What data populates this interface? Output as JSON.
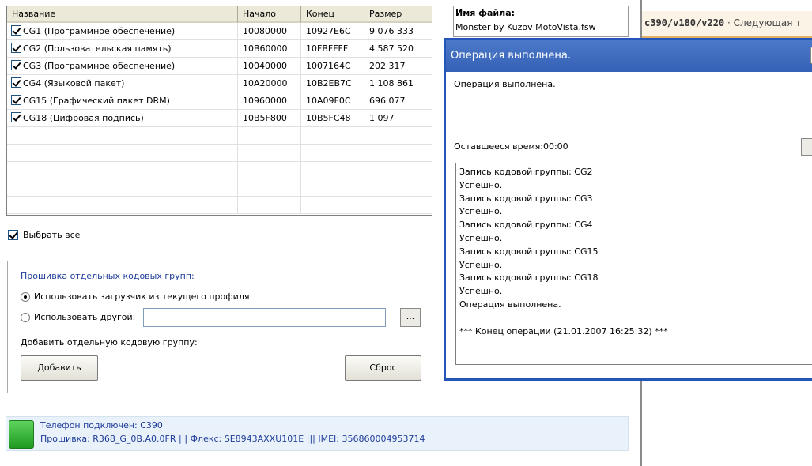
{
  "table": {
    "columns": [
      "Название",
      "Начало",
      "Конец",
      "Размер"
    ],
    "rows": [
      {
        "checked": true,
        "name": "CG1 (Программное обеспечение)",
        "start": "10080000",
        "end": "10927E6C",
        "size": "9 076 333"
      },
      {
        "checked": true,
        "name": "CG2 (Пользовательская память)",
        "start": "10B60000",
        "end": "10FBFFFF",
        "size": "4 587 520"
      },
      {
        "checked": true,
        "name": "CG3 (Программное обеспечение)",
        "start": "10040000",
        "end": "1007164C",
        "size": "202 317"
      },
      {
        "checked": true,
        "name": "CG4 (Языковой пакет)",
        "start": "10A20000",
        "end": "10B2EB7C",
        "size": "1 108 861"
      },
      {
        "checked": true,
        "name": "CG15 (Графический пакет DRM)",
        "start": "10960000",
        "end": "10A09F0C",
        "size": "696 077"
      },
      {
        "checked": true,
        "name": "CG18 (Цифровая подпись)",
        "start": "10B5F800",
        "end": "10B5FC48",
        "size": "1 097"
      }
    ]
  },
  "select_all": {
    "label": "Выбрать все",
    "checked": true
  },
  "group": {
    "title": "Прошивка отдельных кодовых групп:",
    "radio_profile": "Использовать загрузчик из текущего профиля",
    "radio_other": "Использовать другой:",
    "other_path": "",
    "browse_label": "...",
    "add_label": "Добавить отдельную кодовую группу:",
    "add_button": "Добавить",
    "reset_button": "Сброс"
  },
  "status": {
    "line1": "Телефон подключен: C390",
    "line2": "Прошивка: R368_G_0B.A0.0FR ||| Флекс: SE8943AXXU101E ||| IMEI: 356860004953714"
  },
  "file_info": {
    "label": "Имя файла:",
    "file": "Monster by Kuzov MotoVista.fsw"
  },
  "banner": {
    "code": "c390/v180/v220",
    "text": " · Следующая т"
  },
  "dialog": {
    "title": "Операция выполнена.",
    "message": "Операция выполнена.",
    "time_remaining": "Оставшееся время:00:00",
    "log": [
      "Запись кодовой группы: CG2",
      "Успешно.",
      "Запись кодовой группы: CG3",
      "Успешно.",
      "Запись кодовой группы: CG4",
      "Успешно.",
      "Запись кодовой группы: CG15",
      "Успешно.",
      "Запись кодовой группы: CG18",
      "Успешно.",
      "Операция выполнена.",
      "",
      "*** Конец операции (21.01.2007 16:25:32) ***"
    ]
  },
  "colors": {
    "title_bar": "#3d6bbf",
    "link_blue": "#1f3d9a",
    "status_bg": "#e9f2fa",
    "led_green": "#2fb12f"
  }
}
